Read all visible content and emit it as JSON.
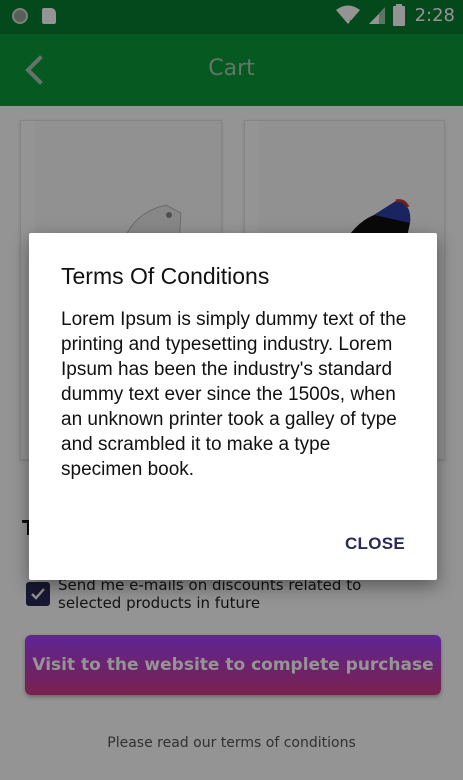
{
  "status_bar": {
    "time": "2:28",
    "icons": [
      "notification-dot-icon",
      "sd-card-icon",
      "wifi-icon",
      "signal-icon",
      "battery-icon"
    ]
  },
  "app_bar": {
    "title": "Cart",
    "back_icon": "chevron-left-icon"
  },
  "colors": {
    "status_bar": "#087e2f",
    "app_bar": "#0a9a3a",
    "checkbox": "#2a2a5a",
    "button_gradient_start": "#a340ff",
    "button_gradient_end": "#d13a86",
    "close_text": "#2a2a5a"
  },
  "products": [
    {
      "image": "white-sneaker"
    },
    {
      "image": "black-blue-sneaker"
    }
  ],
  "checkout": {
    "checkbox_label": "Send me e-mails on discounts related to selected products in future",
    "checkbox_checked": true,
    "visit_button": "Visit to the website to complete purchase",
    "read_terms": "Please read our terms of conditions"
  },
  "dialog": {
    "title": "Terms Of Conditions",
    "body": "Lorem Ipsum is simply dummy text of the printing and typesetting industry. Lorem Ipsum has been the industry's standard dummy text ever since the 1500s, when an unknown printer took a galley of type and scrambled it to make a type specimen book.",
    "close_label": "CLOSE"
  }
}
